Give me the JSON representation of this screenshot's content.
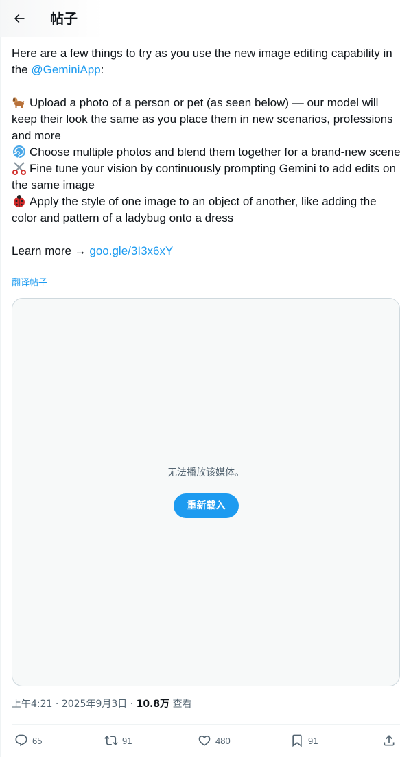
{
  "header": {
    "title": "帖子"
  },
  "post": {
    "intro_text": "Here are a few things to try as you use the new image editing capability in the ",
    "intro_mention": "@GeminiApp",
    "intro_end": ":",
    "items": [
      {
        "emoji": "dog-icon",
        "text": "Upload a photo of a person or pet (as seen below) — our model will keep their look the same as you place them in new scenarios, professions and more"
      },
      {
        "emoji": "swirl-icon",
        "text": "Choose multiple photos and blend them together for a brand-new scene"
      },
      {
        "emoji": "scissors-icon",
        "text": "Fine tune your vision by continuously prompting Gemini to add edits on the same image"
      },
      {
        "emoji": "ladybug-icon",
        "text": "Apply the style of one image to an object of another, like adding the color and pattern of a ladybug onto a dress"
      }
    ],
    "learn_more_text": "Learn more → ",
    "learn_more_link": "goo.gle/3I3x6xY",
    "translate_label": "翻译帖子"
  },
  "media": {
    "error_message": "无法播放该媒体。",
    "reload_label": "重新载入"
  },
  "meta": {
    "time": "上午4:21",
    "sep1": " · ",
    "date": "2025年9月3日",
    "sep2": " · ",
    "views_count": "10.8万",
    "views_label": " 查看"
  },
  "actions": {
    "replies": "65",
    "reposts": "91",
    "likes": "480",
    "bookmarks": "91"
  },
  "colors": {
    "accent": "#1d9bf0",
    "text": "#0f1419",
    "muted": "#536471"
  }
}
